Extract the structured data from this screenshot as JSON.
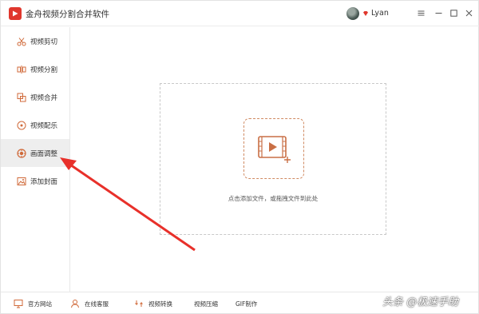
{
  "app": {
    "title": "金舟视频分割合并软件",
    "user_name": "Lyan"
  },
  "sidebar": {
    "items": [
      {
        "label": "视频剪切",
        "icon": "scissors-icon"
      },
      {
        "label": "视频分割",
        "icon": "split-icon"
      },
      {
        "label": "视频合并",
        "icon": "merge-icon"
      },
      {
        "label": "视频配乐",
        "icon": "music-disc-icon"
      },
      {
        "label": "画面调整",
        "icon": "adjust-icon",
        "active": true
      },
      {
        "label": "添加封面",
        "icon": "image-icon"
      }
    ]
  },
  "main": {
    "drop_hint": "点击添加文件，或拖拽文件到此处"
  },
  "bottom": {
    "items": [
      {
        "label": "官方网站",
        "icon": "monitor-icon"
      },
      {
        "label": "在线客服",
        "icon": "support-icon"
      },
      {
        "label": "视频转换",
        "icon": "convert-icon"
      },
      {
        "label": "视频压缩"
      },
      {
        "label": "GIF制作"
      }
    ]
  },
  "watermark": "头条 @极速手助",
  "colors": {
    "brand": "#e0372d",
    "accent": "#d08a62",
    "arrow": "#e8302a",
    "active_bg": "#eeeeee"
  }
}
